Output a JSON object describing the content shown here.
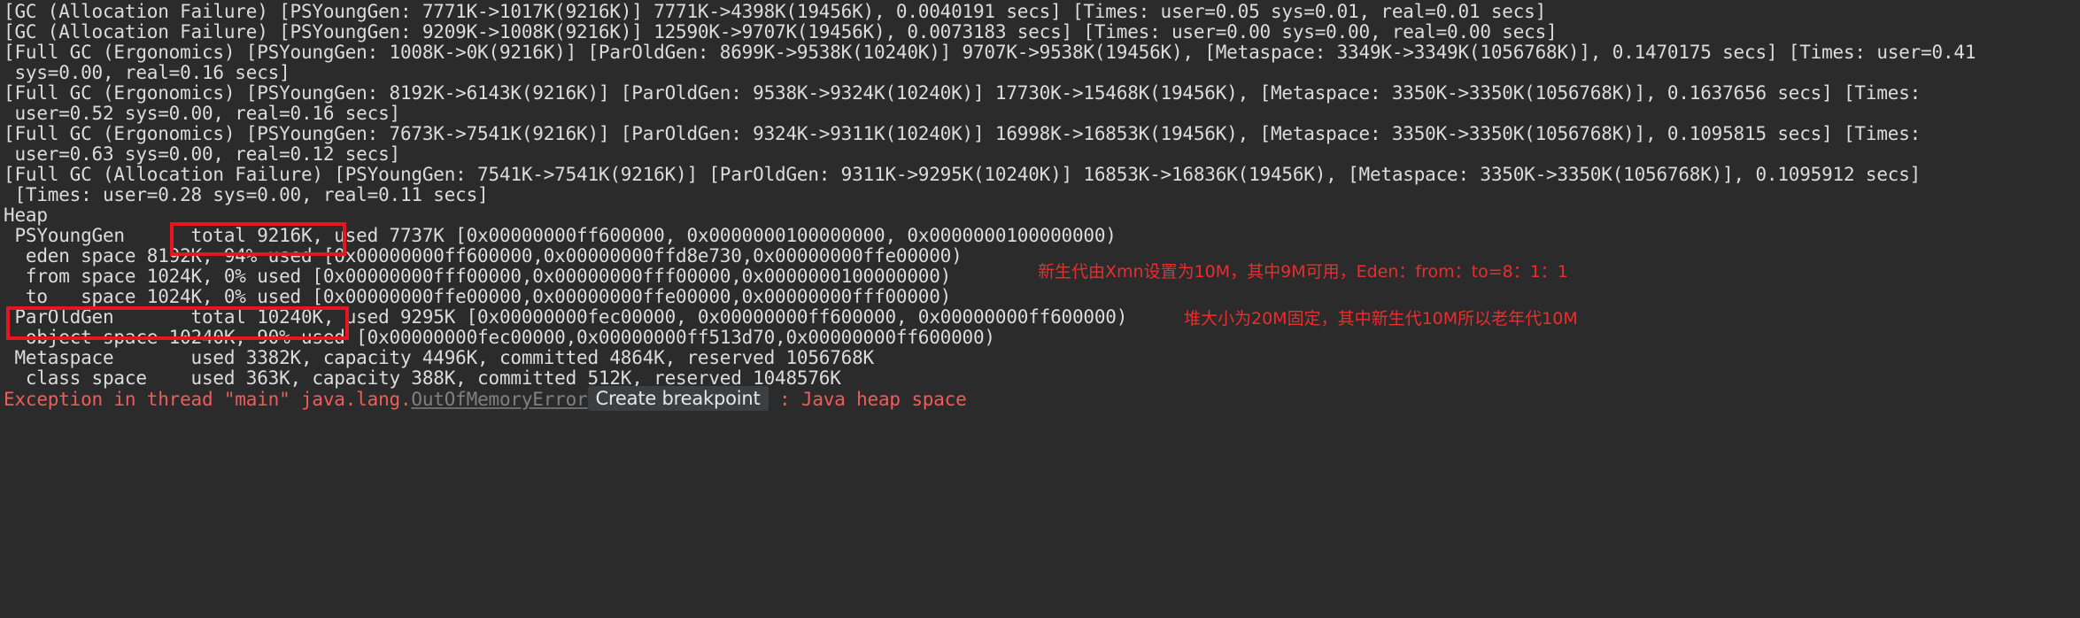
{
  "console": {
    "lines": [
      "[GC (Allocation Failure) [PSYoungGen: 7771K->1017K(9216K)] 7771K->4398K(19456K), 0.0040191 secs] [Times: user=0.05 sys=0.01, real=0.01 secs]",
      "[GC (Allocation Failure) [PSYoungGen: 9209K->1008K(9216K)] 12590K->9707K(19456K), 0.0073183 secs] [Times: user=0.00 sys=0.00, real=0.00 secs]",
      "[Full GC (Ergonomics) [PSYoungGen: 1008K->0K(9216K)] [ParOldGen: 8699K->9538K(10240K)] 9707K->9538K(19456K), [Metaspace: 3349K->3349K(1056768K)], 0.1470175 secs] [Times: user=0.41",
      " sys=0.00, real=0.16 secs]",
      "[Full GC (Ergonomics) [PSYoungGen: 8192K->6143K(9216K)] [ParOldGen: 9538K->9324K(10240K)] 17730K->15468K(19456K), [Metaspace: 3350K->3350K(1056768K)], 0.1637656 secs] [Times:",
      " user=0.52 sys=0.00, real=0.16 secs]",
      "[Full GC (Ergonomics) [PSYoungGen: 7673K->7541K(9216K)] [ParOldGen: 9324K->9311K(10240K)] 16998K->16853K(19456K), [Metaspace: 3350K->3350K(1056768K)], 0.1095815 secs] [Times:",
      " user=0.63 sys=0.00, real=0.12 secs]",
      "[Full GC (Allocation Failure) [PSYoungGen: 7541K->7541K(9216K)] [ParOldGen: 9311K->9295K(10240K)] 16853K->16836K(19456K), [Metaspace: 3350K->3350K(1056768K)], 0.1095912 secs]",
      " [Times: user=0.28 sys=0.00, real=0.11 secs]",
      "Heap",
      " PSYoungGen      total 9216K, used 7737K [0x00000000ff600000, 0x0000000100000000, 0x0000000100000000)",
      "  eden space 8192K, 94% used [0x00000000ff600000,0x00000000ffd8e730,0x00000000ffe00000)",
      "  from space 1024K, 0% used [0x00000000fff00000,0x00000000fff00000,0x0000000100000000)",
      "  to   space 1024K, 0% used [0x00000000ffe00000,0x00000000ffe00000,0x00000000fff00000)",
      " ParOldGen       total 10240K, used 9295K [0x00000000fec00000, 0x00000000ff600000, 0x00000000ff600000)",
      "  object space 10240K, 90% used [0x00000000fec00000,0x00000000ff513d70,0x00000000ff600000)",
      " Metaspace       used 3382K, capacity 4496K, committed 4864K, reserved 1056768K",
      "  class space    used 363K, capacity 388K, committed 512K, reserved 1048576K"
    ],
    "exception": {
      "prefix": "Exception in thread \"main\" java.lang.",
      "link_text": "OutOfMemoryError",
      "breakpoint_button": "Create breakpoint",
      "suffix": " : Java heap space"
    }
  },
  "annotations": {
    "young_gen_note": "新生代由Xmn设置为10M，其中9M可用，Eden：from：to=8：1：1",
    "heap_note": "堆大小为20M固定，其中新生代10M所以老年代10M"
  },
  "colors": {
    "background": "#2b2b2b",
    "text": "#dcdcdc",
    "error": "#f05b5b",
    "highlight_box": "#e5161f",
    "annotation": "#ea2d2d"
  }
}
